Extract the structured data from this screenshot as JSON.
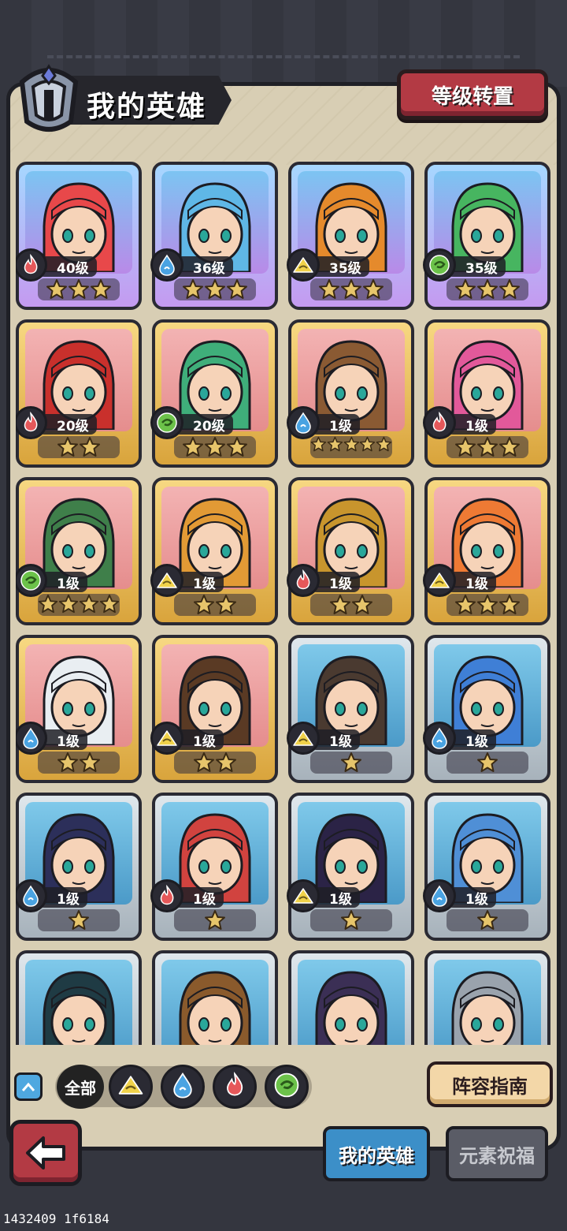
{
  "header": {
    "title": "我的英雄",
    "reset_button": "等级转置"
  },
  "heroes": [
    {
      "level": "40级",
      "stars": 3,
      "element": "fire",
      "frame": "purple",
      "hair": "#e8484a"
    },
    {
      "level": "36级",
      "stars": 3,
      "element": "water",
      "frame": "purple",
      "hair": "#5fb7e6"
    },
    {
      "level": "35级",
      "stars": 3,
      "element": "earth",
      "frame": "purple",
      "hair": "#e58a2c"
    },
    {
      "level": "35级",
      "stars": 3,
      "element": "wind",
      "frame": "purple",
      "hair": "#47b560"
    },
    {
      "level": "20级",
      "stars": 2,
      "element": "fire",
      "frame": "gold",
      "hair": "#c9302c"
    },
    {
      "level": "20级",
      "stars": 3,
      "element": "wind",
      "frame": "gold",
      "hair": "#3fae7a"
    },
    {
      "level": "1级",
      "stars": 5,
      "element": "water",
      "frame": "gold",
      "hair": "#8a5a33"
    },
    {
      "level": "1级",
      "stars": 3,
      "element": "fire",
      "frame": "gold",
      "hair": "#e2599a"
    },
    {
      "level": "1级",
      "stars": 4,
      "element": "wind",
      "frame": "gold",
      "hair": "#3f7f4a"
    },
    {
      "level": "1级",
      "stars": 2,
      "element": "earth",
      "frame": "gold",
      "hair": "#e29a35"
    },
    {
      "level": "1级",
      "stars": 2,
      "element": "fire",
      "frame": "gold",
      "hair": "#c8952d"
    },
    {
      "level": "1级",
      "stars": 3,
      "element": "earth",
      "frame": "gold",
      "hair": "#ee7a34"
    },
    {
      "level": "1级",
      "stars": 2,
      "element": "water",
      "frame": "gold",
      "hair": "#e9eef2"
    },
    {
      "level": "1级",
      "stars": 2,
      "element": "earth",
      "frame": "gold",
      "hair": "#5a3a24"
    },
    {
      "level": "1级",
      "stars": 1,
      "element": "earth",
      "frame": "silver",
      "hair": "#4a3a30"
    },
    {
      "level": "1级",
      "stars": 1,
      "element": "water",
      "frame": "silver",
      "hair": "#3f7fd6"
    },
    {
      "level": "1级",
      "stars": 1,
      "element": "water",
      "frame": "silver",
      "hair": "#2c2f5a"
    },
    {
      "level": "1级",
      "stars": 1,
      "element": "fire",
      "frame": "silver",
      "hair": "#d1433f"
    },
    {
      "level": "1级",
      "stars": 1,
      "element": "earth",
      "frame": "silver",
      "hair": "#2b2346"
    },
    {
      "level": "1级",
      "stars": 1,
      "element": "water",
      "frame": "silver",
      "hair": "#4f8fd6"
    },
    {
      "level": "",
      "stars": 0,
      "element": "",
      "frame": "silver",
      "hair": "#1f3b44"
    },
    {
      "level": "",
      "stars": 0,
      "element": "",
      "frame": "silver",
      "hair": "#8a5a2c"
    },
    {
      "level": "",
      "stars": 0,
      "element": "",
      "frame": "silver",
      "hair": "#3b2f55"
    },
    {
      "level": "",
      "stars": 0,
      "element": "",
      "frame": "silver",
      "hair": "#9aa3ad"
    }
  ],
  "filters": {
    "all_label": "全部",
    "elements": [
      "earth",
      "water",
      "fire",
      "wind"
    ]
  },
  "buttons": {
    "guide": "阵容指南",
    "expand": "^"
  },
  "tabs": {
    "my_heroes": "我的英雄",
    "element_blessing": "元素祝福"
  },
  "footer_id": "1432409 1f6184",
  "colors": {
    "fire": "#e5585a",
    "water": "#4aa3e2",
    "earth": "#f0d24a",
    "wind": "#6cc24a"
  }
}
